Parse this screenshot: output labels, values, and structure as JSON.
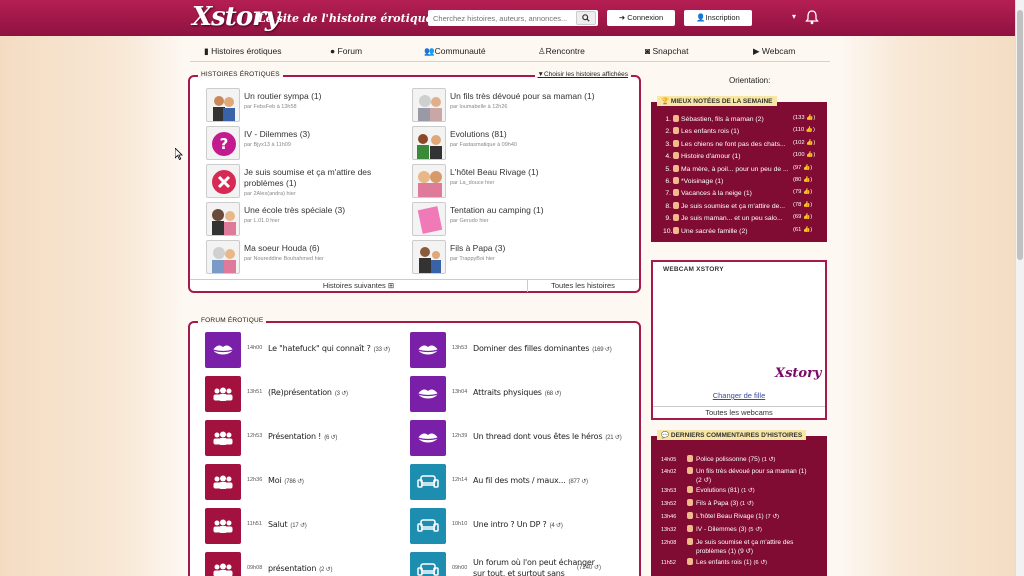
{
  "header": {
    "logo": "Xstory",
    "tagline": "Le site de l'histoire érotique",
    "search_placeholder": "Cherchez histoires, auteurs, annonces...",
    "login": "Connexion",
    "signup": "Inscription"
  },
  "nav": [
    {
      "label": "Histoires érotiques",
      "icon": "book-icon"
    },
    {
      "label": "Forum",
      "icon": "chat-icon"
    },
    {
      "label": "Communauté",
      "icon": "users-icon"
    },
    {
      "label": "Rencontre",
      "icon": "person-icon"
    },
    {
      "label": "Snapchat",
      "icon": "camera-icon"
    },
    {
      "label": "Webcam",
      "icon": "video-icon"
    }
  ],
  "stories_panel": {
    "title": "HISTOIRES ÉROTIQUES",
    "filter_link": "Choisir les histoires affichées",
    "next_link": "Histoires suivantes",
    "all_link": "Toutes les histoires",
    "items": [
      {
        "title": "Un routier sympa (1)",
        "meta": "par FebsFeb à 13h58"
      },
      {
        "title": "Un fils très dévoué pour sa maman (1)",
        "meta": "par loumabelle à 12h26"
      },
      {
        "title": "IV - Dilemmes (3)",
        "meta": "par Bjyx13 à 11h09"
      },
      {
        "title": "Evolutions (81)",
        "meta": "par Fastasmatique à 09h40"
      },
      {
        "title": "Je suis soumise et ça m'attire des",
        "title_line2": "problèmes (1)",
        "meta": "par 2Alex(andra) hier"
      },
      {
        "title": "L'hôtel Beau Rivage (1)",
        "meta": "par La_douce hier"
      },
      {
        "title": "Une école très spéciale (3)",
        "meta": "par L.01.0 hier"
      },
      {
        "title": "Tentation au camping (1)",
        "meta": "par Gerudo hier"
      },
      {
        "title": "Ma soeur Houda (6)",
        "meta": "par Noureddine Bouhahmed hier"
      },
      {
        "title": "Fils à Papa (3)",
        "meta": "par TrappyBoi hier"
      }
    ]
  },
  "forum_panel": {
    "title": "FORUM ÉROTIQUE",
    "items": [
      {
        "time": "14h00",
        "title": "Le \"hatefuck\" qui connaît ?",
        "count": "(33 ↺)",
        "icon": "lips-icon",
        "color": "#7a1fa8"
      },
      {
        "time": "13h53",
        "title": "Dominer des filles dominantes",
        "count": "(169 ↺)",
        "icon": "lips-icon",
        "color": "#7a1fa8"
      },
      {
        "time": "13h51",
        "title": "(Re)présentation",
        "count": "(3 ↺)",
        "icon": "group-icon",
        "color": "#a3123f"
      },
      {
        "time": "13h04",
        "title": "Attraits physiques",
        "count": "(68 ↺)",
        "icon": "lips-icon",
        "color": "#7a1fa8"
      },
      {
        "time": "12h53",
        "title": "Présentation !",
        "count": "(6 ↺)",
        "icon": "group-icon",
        "color": "#a3123f"
      },
      {
        "time": "12h39",
        "title": "Un thread dont vous êtes le héros",
        "count": "(21 ↺)",
        "icon": "lips-icon",
        "color": "#7a1fa8"
      },
      {
        "time": "12h36",
        "title": "Moi",
        "count": "(786 ↺)",
        "icon": "group-icon",
        "color": "#a3123f"
      },
      {
        "time": "12h14",
        "title": "Au fil des mots / maux...",
        "count": "(877 ↺)",
        "icon": "sofa-icon",
        "color": "#1d8db0"
      },
      {
        "time": "11h51",
        "title": "Salut",
        "count": "(17 ↺)",
        "icon": "group-icon",
        "color": "#a3123f"
      },
      {
        "time": "10h10",
        "title": "Une intro ? Un DP ?",
        "count": "(4 ↺)",
        "icon": "sofa-icon",
        "color": "#1d8db0"
      },
      {
        "time": "09h08",
        "title": "présentation",
        "count": "(2 ↺)",
        "icon": "group-icon",
        "color": "#a3123f"
      },
      {
        "time": "09h00",
        "title": "Un forum où l'on peut échanger",
        "title_line2": "sur tout, et surtout sans",
        "count": "(7240 ↺)",
        "icon": "sofa-icon",
        "color": "#1d8db0"
      }
    ]
  },
  "sidebar": {
    "orientation_label": "Orientation:",
    "top_rated_title": "MIEUX NOTÉES DE LA SEMAINE",
    "top_rated": [
      {
        "rank": "1.",
        "title": "Sébastien, fils à maman (2)",
        "score": "(133 👍)"
      },
      {
        "rank": "2.",
        "title": "Les enfants rois (1)",
        "score": "(110 👍)"
      },
      {
        "rank": "3.",
        "title": "Les chiens ne font pas des chats...",
        "score": "(102 👍)"
      },
      {
        "rank": "4.",
        "title": "Histoire d'amour (1)",
        "score": "(100 👍)"
      },
      {
        "rank": "5.",
        "title": "Ma mère, à poil... pour un peu de ...",
        "score": "(97 👍)"
      },
      {
        "rank": "6.",
        "title": "*Voisinage (1)",
        "score": "(80 👍)"
      },
      {
        "rank": "7.",
        "title": "Vacances à la neige (1)",
        "score": "(79 👍)"
      },
      {
        "rank": "8.",
        "title": "Je suis soumise et ça m'attire de...",
        "score": "(78 👍)"
      },
      {
        "rank": "9.",
        "title": "Je suis maman... et un peu salo...",
        "score": "(69 👍)"
      },
      {
        "rank": "10.",
        "title": "Une sacrée famille (2)",
        "score": "(61 👍)"
      }
    ],
    "webcam_title": "WEBCAM XSTORY",
    "webcam_logo": "Xstory",
    "webcam_change": "Changer de fille",
    "webcam_all": "Toutes les webcams",
    "comments_title": "DERNIERS COMMENTAIRES D'HISTOIRES",
    "comments": [
      {
        "time": "14h05",
        "title": "Police polissonne (75)",
        "count": "(1 ↺)"
      },
      {
        "time": "14h02",
        "title": "Un fils très dévoué pour sa maman (1)",
        "title_line2": "(2 ↺)"
      },
      {
        "time": "13h53",
        "title": "Evolutions (81)",
        "count": "(1 ↺)"
      },
      {
        "time": "13h52",
        "title": "Fils à Papa (3)",
        "count": "(1 ↺)"
      },
      {
        "time": "13h46",
        "title": "L'hôtel Beau Rivage (1)",
        "count": "(7 ↺)"
      },
      {
        "time": "13h32",
        "title": "IV - Dilemmes (3)",
        "count": "(5 ↺)"
      },
      {
        "time": "12h08",
        "title": "Je suis soumise et ça m'attire des",
        "title_line2": "problèmes (1)",
        "count": "(9 ↺)"
      },
      {
        "time": "11h52",
        "title": "Les enfants rois (1)",
        "count": "(6 ↺)"
      }
    ]
  }
}
